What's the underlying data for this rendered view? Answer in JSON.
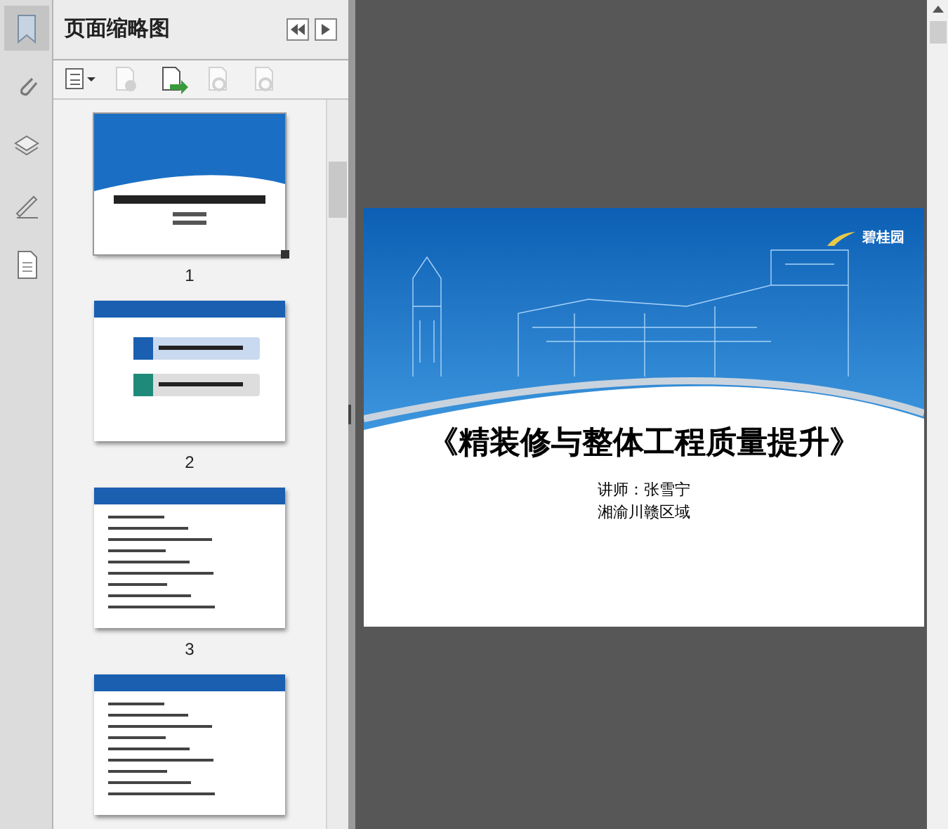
{
  "sidebar": {
    "tools": [
      {
        "kind": "bookmark",
        "selected": true
      },
      {
        "kind": "attachment",
        "selected": false
      },
      {
        "kind": "layers",
        "selected": false
      },
      {
        "kind": "signature",
        "selected": false
      },
      {
        "kind": "page",
        "selected": false
      }
    ]
  },
  "panel": {
    "title": "页面缩略图",
    "thumbnails": [
      {
        "kind": "cover",
        "page": "1",
        "selected": true
      },
      {
        "kind": "contents",
        "page": "2",
        "selected": false
      },
      {
        "kind": "list",
        "page": "3",
        "selected": false
      },
      {
        "kind": "list",
        "selected": false
      }
    ]
  },
  "toolbar": [
    {
      "kind": "options",
      "disabled": false
    },
    {
      "kind": "delete",
      "disabled": true
    },
    {
      "kind": "insert",
      "disabled": false
    },
    {
      "kind": "undo",
      "disabled": true
    },
    {
      "kind": "redo",
      "disabled": true
    }
  ],
  "slide": {
    "logo": "碧桂园",
    "title": "《精装修与整体工程质量提升》",
    "lines": [
      "讲师：张雪宁",
      "湘渝川赣区域"
    ]
  }
}
